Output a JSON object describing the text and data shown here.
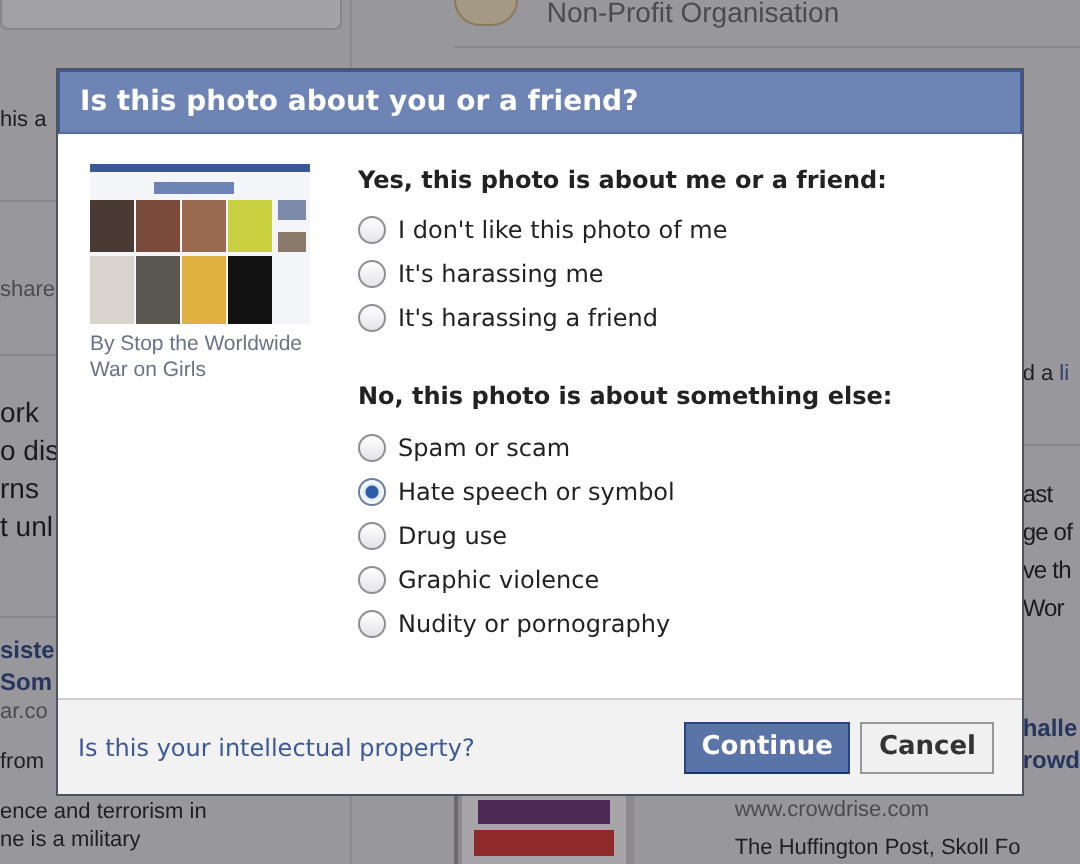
{
  "background": {
    "organisation": "Non-Profit Organisation",
    "left_blocks": [
      {
        "lines": [
          {
            "text": "his a",
            "kind": "body"
          }
        ]
      },
      {
        "lines": [
          {
            "text": "share",
            "kind": "meta"
          }
        ]
      },
      {
        "lines": [
          {
            "text": "ork",
            "kind": "lead"
          },
          {
            "text": "o dis",
            "kind": "lead"
          },
          {
            "text": "rns",
            "kind": "lead"
          },
          {
            "text": "t unl",
            "kind": "lead"
          }
        ]
      },
      {
        "lines": [
          {
            "text": "siste",
            "kind": "title"
          },
          {
            "text": "Som",
            "kind": "title"
          },
          {
            "text": "ar.co",
            "kind": "meta"
          }
        ]
      },
      {
        "lines": [
          {
            "text": "from",
            "kind": "body"
          },
          {
            "text": "ence and terrorism in",
            "kind": "body"
          },
          {
            "text": "ne is a military",
            "kind": "body"
          }
        ]
      }
    ],
    "right_blocks": [
      {
        "lines": [
          {
            "text": "d a",
            "kind": "body"
          },
          {
            "text": "li",
            "kind": "link"
          }
        ]
      },
      {
        "lines": [
          {
            "text": "ast",
            "kind": "lead"
          },
          {
            "text": "ge of",
            "kind": "lead"
          },
          {
            "text": "ve th",
            "kind": "lead"
          },
          {
            "text": "Wor",
            "kind": "lead"
          }
        ]
      },
      {
        "lines": [
          {
            "text": "halle",
            "kind": "title"
          },
          {
            "text": "rowd",
            "kind": "title"
          }
        ]
      }
    ],
    "bottom_lines": [
      {
        "text": "www.crowdrise.com",
        "kind": "meta"
      },
      {
        "text": "The Huffington Post, Skoll Fo",
        "kind": "body"
      }
    ]
  },
  "dialog": {
    "title": "Is this photo about you or a friend?",
    "thumbnail": {
      "kind": "picture",
      "caption": "By Stop the Worldwide War on Girls"
    },
    "sections": [
      {
        "heading": "Yes, this photo is about me or a friend:",
        "options": [
          {
            "label": "I don't like this photo of me",
            "selected": false
          },
          {
            "label": "It's harassing me",
            "selected": false
          },
          {
            "label": "It's harassing a friend",
            "selected": false
          }
        ]
      },
      {
        "heading": "No, this photo is about something else:",
        "options": [
          {
            "label": "Spam or scam",
            "selected": false
          },
          {
            "label": "Hate speech or symbol",
            "selected": true
          },
          {
            "label": "Drug use",
            "selected": false
          },
          {
            "label": "Graphic violence",
            "selected": false
          },
          {
            "label": "Nudity or pornography",
            "selected": false
          }
        ]
      }
    ],
    "footer": {
      "link": "Is this your intellectual property?",
      "buttons": [
        {
          "label": "Continue",
          "kind": "primary"
        },
        {
          "label": "Cancel",
          "kind": "secondary"
        }
      ]
    }
  }
}
